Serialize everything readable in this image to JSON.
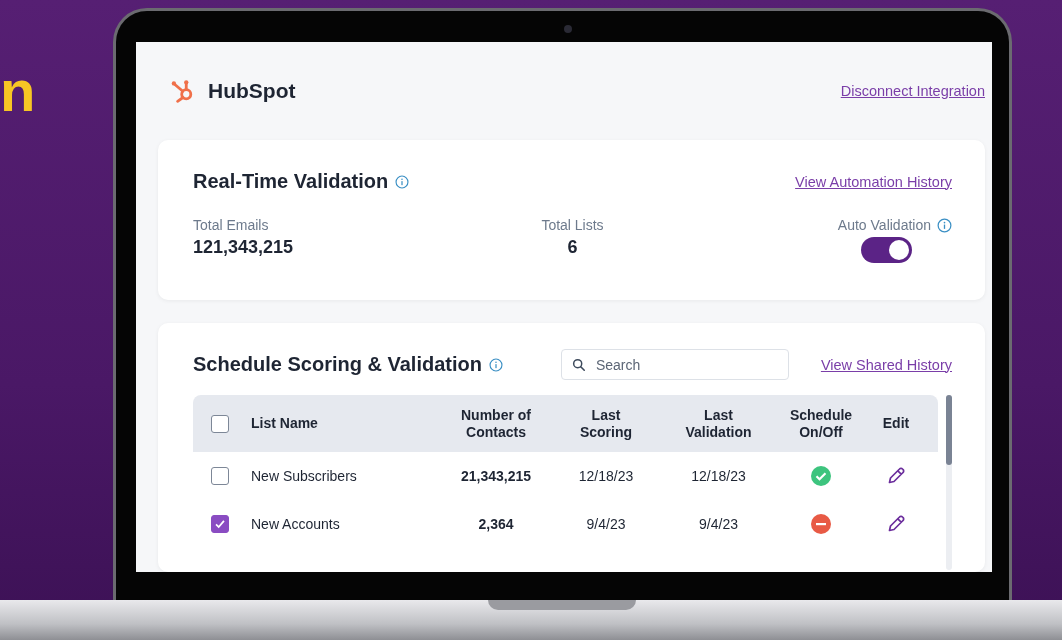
{
  "headline_fragment": "n",
  "header": {
    "app_name": "HubSpot",
    "disconnect_link": "Disconnect Integration"
  },
  "realtime": {
    "title": "Real-Time Validation",
    "history_link": "View Automation History",
    "stats": [
      {
        "label": "Total Emails",
        "value": "121,343,215"
      },
      {
        "label": "Total Lists",
        "value": "6"
      }
    ],
    "auto_validation": {
      "label": "Auto Validation",
      "on": true
    }
  },
  "schedule": {
    "title": "Schedule Scoring & Validation",
    "search": {
      "placeholder": "Search"
    },
    "history_link": "View Shared History",
    "table": {
      "select_all_checked": false,
      "columns": [
        "List Name",
        "Number of Contacts",
        "Last Scoring",
        "Last Validation",
        "Schedule On/Off",
        "Edit"
      ],
      "rows": [
        {
          "checked": false,
          "name": "New Subscribers",
          "contacts": "21,343,215",
          "last_scoring": "12/18/23",
          "last_validation": "12/18/23",
          "schedule_on": true
        },
        {
          "checked": true,
          "name": "New Accounts",
          "contacts": "2,364",
          "last_scoring": "9/4/23",
          "last_validation": "9/4/23",
          "schedule_on": false
        }
      ]
    }
  }
}
